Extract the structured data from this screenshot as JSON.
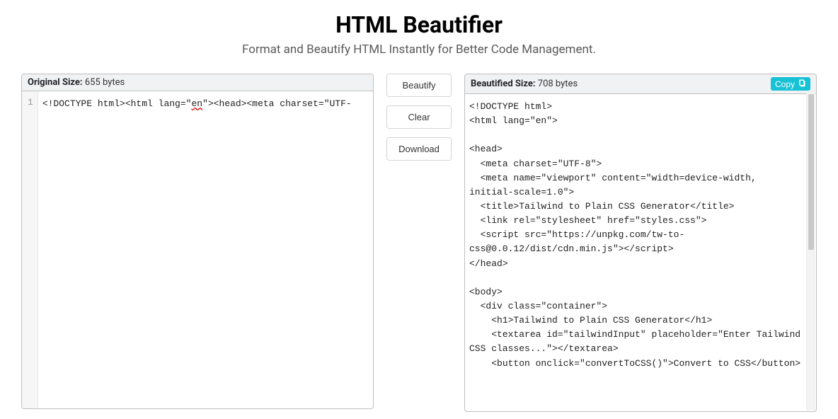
{
  "header": {
    "title": "HTML Beautifier",
    "subtitle": "Format and Beautify HTML Instantly for Better Code Management."
  },
  "left": {
    "size_label": "Original Size:",
    "size_value": "655 bytes",
    "line_number": "1",
    "code_prefix": "<!DOCTYPE html><html lang=\"",
    "code_lang": "en",
    "code_suffix": "\"><head><meta charset=\"UTF-"
  },
  "buttons": {
    "beautify": "Beautify",
    "clear": "Clear",
    "download": "Download"
  },
  "right": {
    "size_label": "Beautified Size:",
    "size_value": "708 bytes",
    "copy_label": "Copy",
    "code": "<!DOCTYPE html>\n<html lang=\"en\">\n\n<head>\n  <meta charset=\"UTF-8\">\n  <meta name=\"viewport\" content=\"width=device-width, initial-scale=1.0\">\n  <title>Tailwind to Plain CSS Generator</title>\n  <link rel=\"stylesheet\" href=\"styles.css\">\n  <script src=\"https://unpkg.com/tw-to-css@0.0.12/dist/cdn.min.js\"></script>\n</head>\n\n<body>\n  <div class=\"container\">\n    <h1>Tailwind to Plain CSS Generator</h1>\n    <textarea id=\"tailwindInput\" placeholder=\"Enter Tailwind CSS classes...\"></textarea>\n    <button onclick=\"convertToCSS()\">Convert to CSS</button>"
  }
}
